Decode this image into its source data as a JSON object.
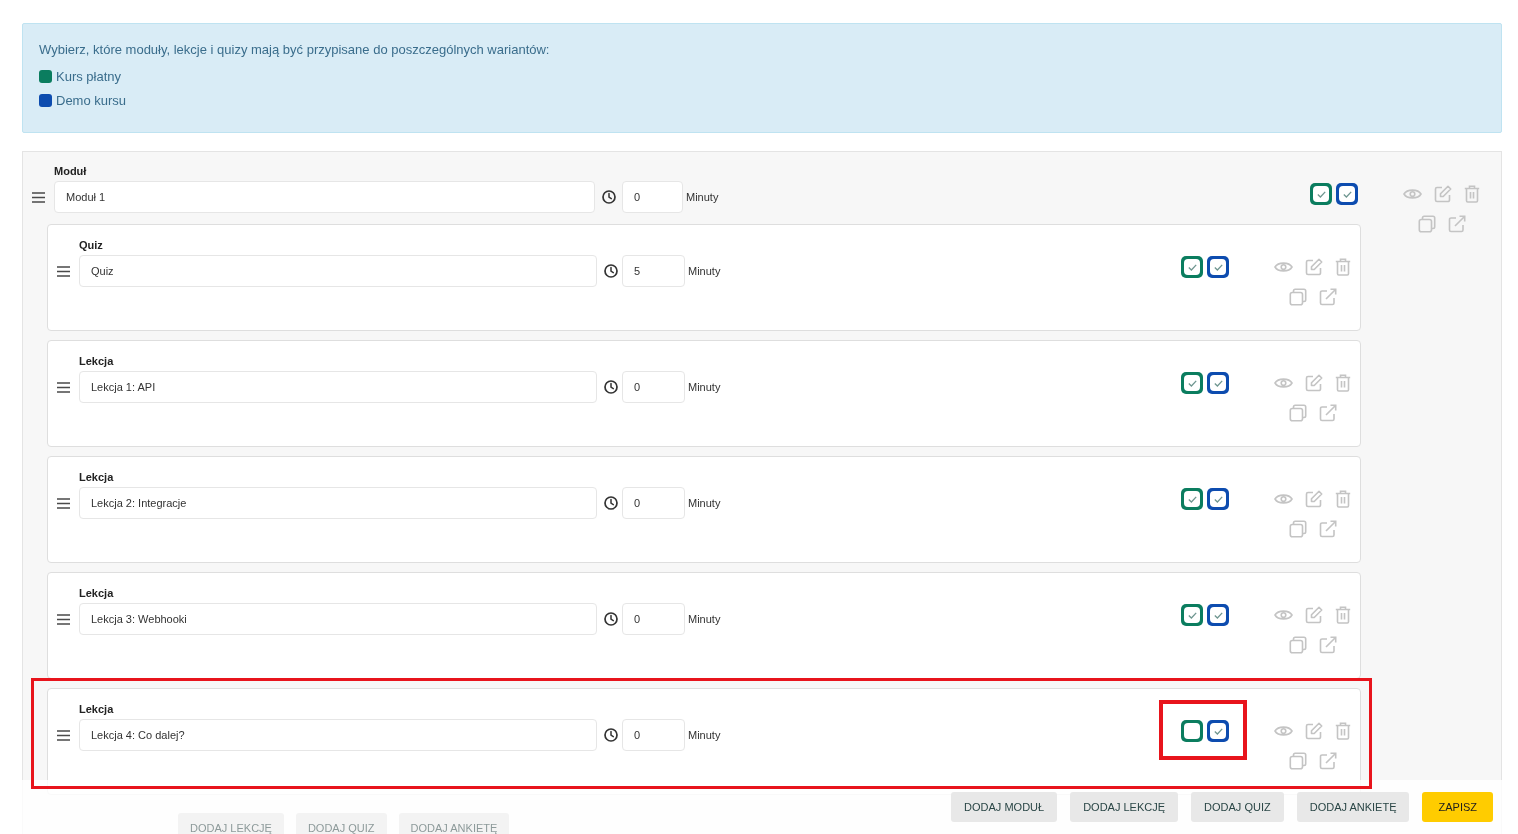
{
  "info": {
    "text": "Wybierz, które moduły, lekcje i quizy mają być przypisane do poszczególnych wariantów:",
    "variants": [
      {
        "label": "Kurs płatny",
        "color": "#0b7d5f"
      },
      {
        "label": "Demo kursu",
        "color": "#0d4caf"
      }
    ]
  },
  "module": {
    "label": "Moduł",
    "title": "Moduł 1",
    "minutes": "0",
    "unit": "Minuty",
    "assigned": [
      {
        "checked": true
      },
      {
        "checked": true
      }
    ],
    "items": [
      {
        "label": "Quiz",
        "title": "Quiz",
        "minutes": "5",
        "unit": "Minuty",
        "assigned": [
          {
            "checked": true
          },
          {
            "checked": true
          }
        ],
        "highlighted": false,
        "checkboxes_highlighted": false
      },
      {
        "label": "Lekcja",
        "title": "Lekcja 1: API",
        "minutes": "0",
        "unit": "Minuty",
        "assigned": [
          {
            "checked": true
          },
          {
            "checked": true
          }
        ],
        "highlighted": false,
        "checkboxes_highlighted": false
      },
      {
        "label": "Lekcja",
        "title": "Lekcja 2: Integracje",
        "minutes": "0",
        "unit": "Minuty",
        "assigned": [
          {
            "checked": true
          },
          {
            "checked": true
          }
        ],
        "highlighted": false,
        "checkboxes_highlighted": false
      },
      {
        "label": "Lekcja",
        "title": "Lekcja 3: Webhooki",
        "minutes": "0",
        "unit": "Minuty",
        "assigned": [
          {
            "checked": true
          },
          {
            "checked": true
          }
        ],
        "highlighted": false,
        "checkboxes_highlighted": false
      },
      {
        "label": "Lekcja",
        "title": "Lekcja 4: Co dalej?",
        "minutes": "0",
        "unit": "Minuty",
        "assigned": [
          {
            "checked": false
          },
          {
            "checked": true
          }
        ],
        "highlighted": true,
        "checkboxes_highlighted": true
      }
    ],
    "add_buttons": [
      {
        "label": "DODAJ LEKCJĘ"
      },
      {
        "label": "DODAJ QUIZ"
      },
      {
        "label": "DODAJ ANKIETĘ"
      }
    ]
  },
  "footer": {
    "buttons": [
      {
        "label": "DODAJ MODUŁ",
        "kind": "secondary"
      },
      {
        "label": "DODAJ LEKCJĘ",
        "kind": "secondary"
      },
      {
        "label": "DODAJ QUIZ",
        "kind": "secondary"
      },
      {
        "label": "DODAJ ANKIETĘ",
        "kind": "secondary"
      },
      {
        "label": "ZAPISZ",
        "kind": "primary"
      }
    ]
  }
}
